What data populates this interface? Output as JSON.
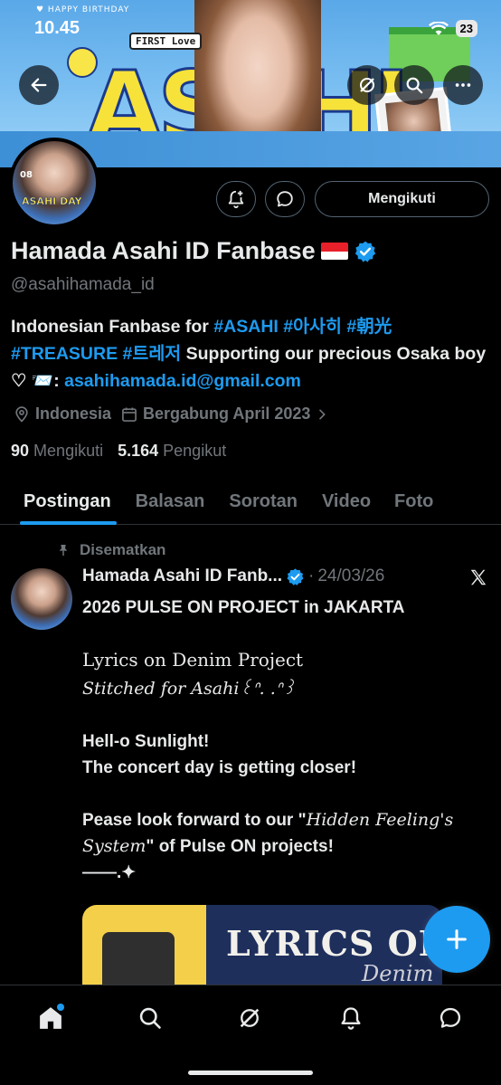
{
  "status_bar": {
    "time": "10.45",
    "battery": "23",
    "wifi_icon": "wifi-icon"
  },
  "banner": {
    "small_text": "♥ HAPPY BIRTHDAY",
    "sticker_text": "FIRST Love",
    "big_letters": "ASAHI"
  },
  "header_buttons": {
    "back_icon": "arrow-left-icon",
    "grok_icon": "grok-icon",
    "search_icon": "search-icon",
    "more_icon": "more-icon"
  },
  "avatar": {
    "number": "08",
    "label": "ASAHI DAY"
  },
  "actions": {
    "notify_icon": "bell-plus-icon",
    "message_icon": "message-icon",
    "follow_label": "Mengikuti"
  },
  "profile": {
    "display_name": "Hamada Asahi ID Fanbase",
    "handle": "@asahihamada_id",
    "bio": {
      "part1": "Indonesian Fanbase for ",
      "tag1": "#ASAHI",
      "tag2": "#아사히",
      "tag3": "#朝光",
      "tag4": "#TREASURE",
      "tag5": "#트레저",
      "part2": " Supporting our precious Osaka boy ♡ ",
      "mail_emoji": "📨",
      "colon": ": ",
      "email": "asahihamada.id@gmail.com"
    },
    "location": "Indonesia",
    "joined": "Bergabung April 2023",
    "following_count": "90",
    "following_label": "Mengikuti",
    "followers_count": "5.164",
    "followers_label": "Pengikut"
  },
  "tabs": [
    {
      "label": "Postingan",
      "active": true
    },
    {
      "label": "Balasan",
      "active": false
    },
    {
      "label": "Sorotan",
      "active": false
    },
    {
      "label": "Video",
      "active": false
    },
    {
      "label": "Foto",
      "active": false
    }
  ],
  "post": {
    "pinned_label": "Disematkan",
    "author": "Hamada Asahi ID Fanb...",
    "separator": "·",
    "date": "24/03/26",
    "line1": "2026 PULSE ON PROJECT in JAKARTA",
    "line2": "Lyrics on Denim Project",
    "line3": "Stitched  for Asahi꒰ᐢ. .ᐢ꒱",
    "line4": "Hell-o Sunlight!",
    "line5": "The concert day is getting closer!",
    "line6_a": "Pease look forward to our \"",
    "line6_b": "Hidden Feeling's System",
    "line6_c": "\" of Pulse ON projects!",
    "line7": "——.✦",
    "media_title": "LYRICS ON",
    "media_sub": "Denim"
  },
  "fab": {
    "icon": "plus-icon"
  },
  "bottom_nav": [
    {
      "icon": "home-icon",
      "active": true
    },
    {
      "icon": "search-icon"
    },
    {
      "icon": "grok-icon"
    },
    {
      "icon": "bell-icon"
    },
    {
      "icon": "message-icon"
    }
  ],
  "colors": {
    "accent": "#1d9bf0",
    "muted": "#71767b",
    "text": "#e7e9ea",
    "background": "#000000"
  }
}
